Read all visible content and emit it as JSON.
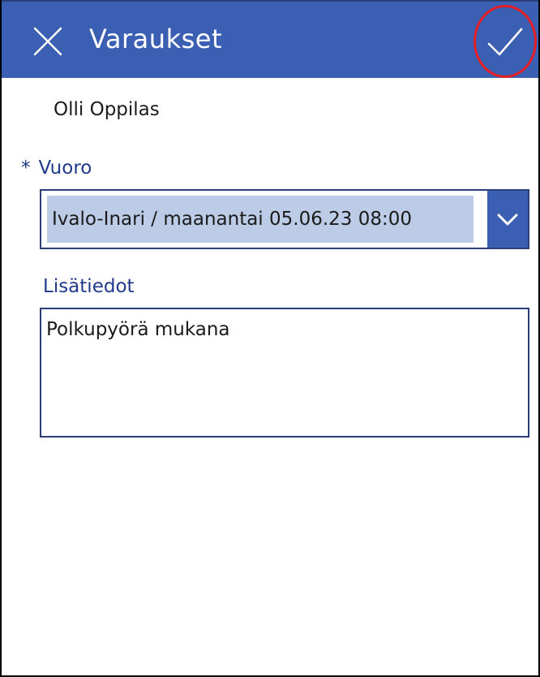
{
  "header": {
    "title": "Varaukset",
    "close_icon": "close-icon",
    "confirm_icon": "checkmark-icon",
    "background_color": "#3b5fb3"
  },
  "student": {
    "name": "Olli Oppilas"
  },
  "shift": {
    "required_marker": "*",
    "label": "Vuoro",
    "selected_value": "Ivalo-Inari / maanantai 05.06.23 08:00",
    "dropdown_icon": "chevron-down-icon"
  },
  "additional_info": {
    "label": "Lisätiedot",
    "value": "Polkupyörä mukana"
  },
  "colors": {
    "accent": "#3b5fb3",
    "label_text": "#1f3a8a",
    "selection_bg": "#bccbe6",
    "highlight": "#e31e24"
  }
}
